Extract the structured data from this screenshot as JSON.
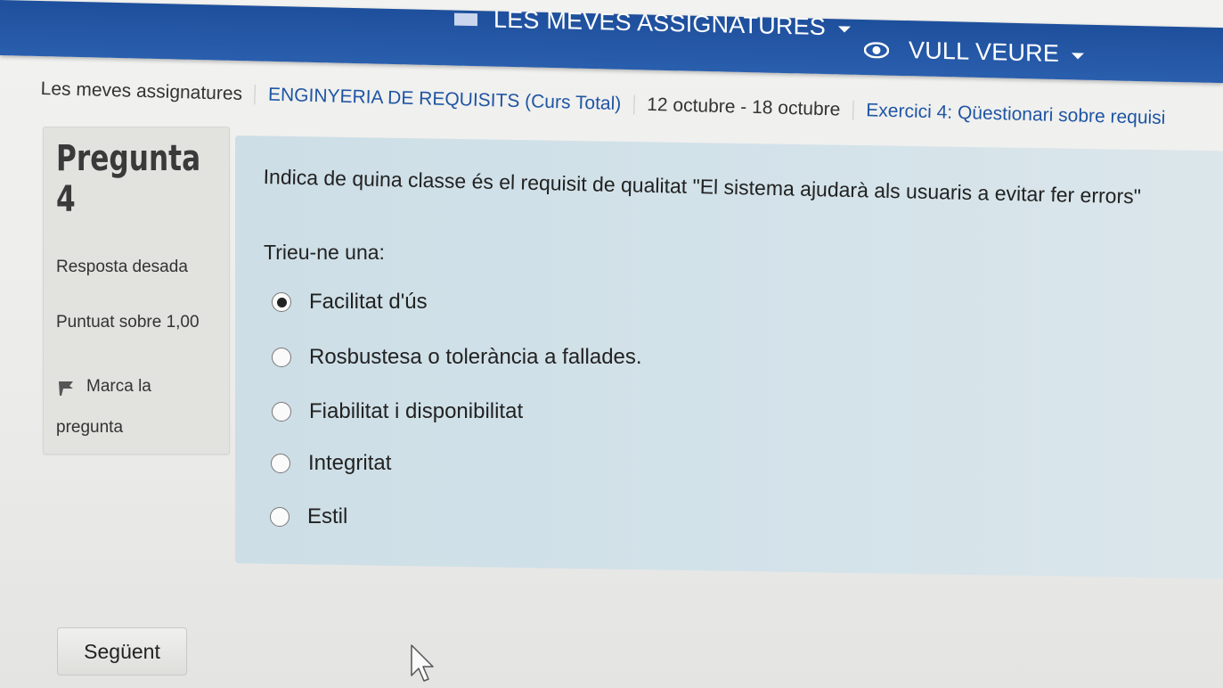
{
  "nav": {
    "my_courses": "LES MEVES ASSIGNATURES",
    "view": "VULL VEURE"
  },
  "breadcrumb": [
    "Les meves assignatures",
    "ENGINYERIA DE REQUISITS (Curs Total)",
    "12 octubre - 18 octubre",
    "Exercici 4: Qüestionari sobre requisi"
  ],
  "question_info": {
    "title_word": "Pregunta",
    "number": "4",
    "status": "Resposta desada",
    "grade": "Puntuat sobre 1,00",
    "flag_label_line1": "Marca la",
    "flag_label_line2": "pregunta"
  },
  "question": {
    "text": "Indica de quina classe és el requisit de qualitat \"El sistema ajudarà als usuaris a evitar fer errors\"",
    "prompt": "Trieu-ne una:",
    "options": [
      {
        "label": "Facilitat d'ús",
        "selected": true
      },
      {
        "label": "Rosbustesa o tolerància a fallades.",
        "selected": false
      },
      {
        "label": "Fiabilitat i disponibilitat",
        "selected": false
      },
      {
        "label": "Integritat",
        "selected": false
      },
      {
        "label": "Estil",
        "selected": false
      }
    ]
  },
  "actions": {
    "next": "Següent"
  },
  "colors": {
    "navbar": "#1e4f9c",
    "link": "#1f55a3",
    "question_bg": "#cddee6",
    "info_bg": "#e2e2df"
  }
}
